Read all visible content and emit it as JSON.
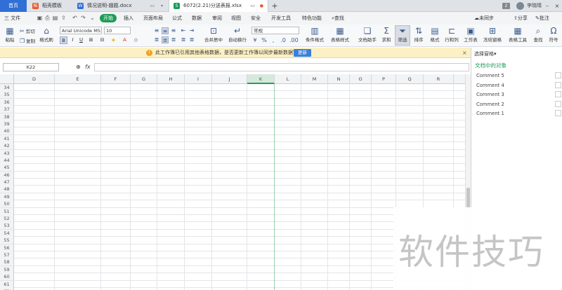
{
  "title_bar": {
    "home_tab": "首页",
    "tabs": [
      {
        "label": "稻壳模板",
        "icon": "daoke-icon",
        "color": "#e8562a"
      },
      {
        "label": "情况说明-翘题.docx",
        "icon": "word-doc-icon",
        "color": "#2f6fd6"
      },
      {
        "label": "6072(2.21)分送表报.xlsx",
        "icon": "excel-doc-icon",
        "color": "#1e9b56",
        "active": true
      }
    ],
    "page_count": "2",
    "user": "李晓晴"
  },
  "menu": {
    "file": "三 文件",
    "items": [
      "开始",
      "插入",
      "页面布局",
      "公式",
      "数据",
      "审阅",
      "视图",
      "安全",
      "开发工具",
      "特色功能"
    ],
    "active_item": "开始",
    "search": "查找",
    "sync": "未同步",
    "share": "分享",
    "comment": "批注"
  },
  "ribbon": {
    "cut": "剪切",
    "paste": "粘贴",
    "copy": "复制",
    "format_painter": "格式刷",
    "font_name": "Arial Unicode MS",
    "font_size": "10",
    "merge_center": "合并居中",
    "wrap_text": "自动换行",
    "number_format": "常规",
    "conditional_format": "条件格式",
    "table_style": "表格样式",
    "doc_assist": "文档助手",
    "sum": "求和",
    "filter": "筛选",
    "sort": "排序",
    "format": "格式",
    "row_col": "行和列",
    "worksheet": "工作表",
    "freeze": "冻结窗格",
    "table_tools": "表格工具",
    "find": "查找",
    "symbol": "符号"
  },
  "notification": {
    "text": "此工作簿已引用其他表格数据，是否更新工作簿以同步最新数据？",
    "button": "更新"
  },
  "formula_bar": {
    "cell_ref": "K22",
    "fx": "fx",
    "formula": ""
  },
  "grid": {
    "columns": [
      "D",
      "E",
      "F",
      "G",
      "H",
      "I",
      "J",
      "K",
      "L",
      "M",
      "N",
      "O",
      "P",
      "Q",
      "R"
    ],
    "selected_column": "K",
    "rows": [
      "34",
      "35",
      "36",
      "37",
      "38",
      "39",
      "40",
      "41",
      "42",
      "43",
      "44",
      "45",
      "46",
      "47",
      "48",
      "49",
      "50",
      "51",
      "52",
      "53",
      "54",
      "55",
      "56",
      "57",
      "58",
      "59",
      "60",
      "61",
      "62"
    ]
  },
  "selection_pane": {
    "title": "选择窗格",
    "subtitle": "文档中的对象",
    "items": [
      "Comment 5",
      "Comment 4",
      "Comment 3",
      "Comment 2",
      "Comment 1"
    ]
  },
  "watermark": "软件技巧"
}
